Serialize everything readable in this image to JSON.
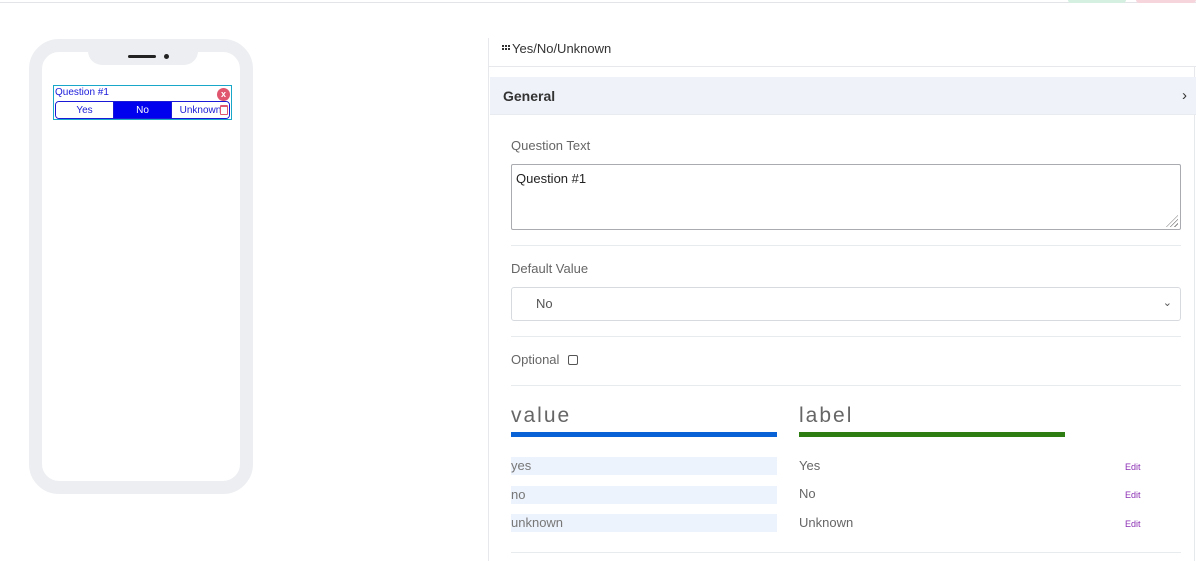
{
  "preview": {
    "question_title": "Question #1",
    "options": [
      "Yes",
      "No",
      "Unknown"
    ],
    "selected": "No",
    "close_glyph": "x",
    "trash_icon": "trash-icon"
  },
  "panel": {
    "title": "Yes/No/Unknown",
    "section": {
      "title": "General",
      "chevron": "›"
    },
    "question_text": {
      "label": "Question Text",
      "value": "Question #1"
    },
    "default_value": {
      "label": "Default Value",
      "value": "No",
      "chevron": "⌄"
    },
    "optional": {
      "label": "Optional",
      "checked": false
    },
    "table": {
      "value_header": "value",
      "label_header": "label",
      "value_color": "#0a63d6",
      "label_color": "#2e7d12",
      "rows": [
        {
          "value": "yes",
          "label": "Yes",
          "action": "Edit"
        },
        {
          "value": "no",
          "label": "No",
          "action": "Edit"
        },
        {
          "value": "unknown",
          "label": "Unknown",
          "action": "Edit"
        }
      ]
    }
  }
}
